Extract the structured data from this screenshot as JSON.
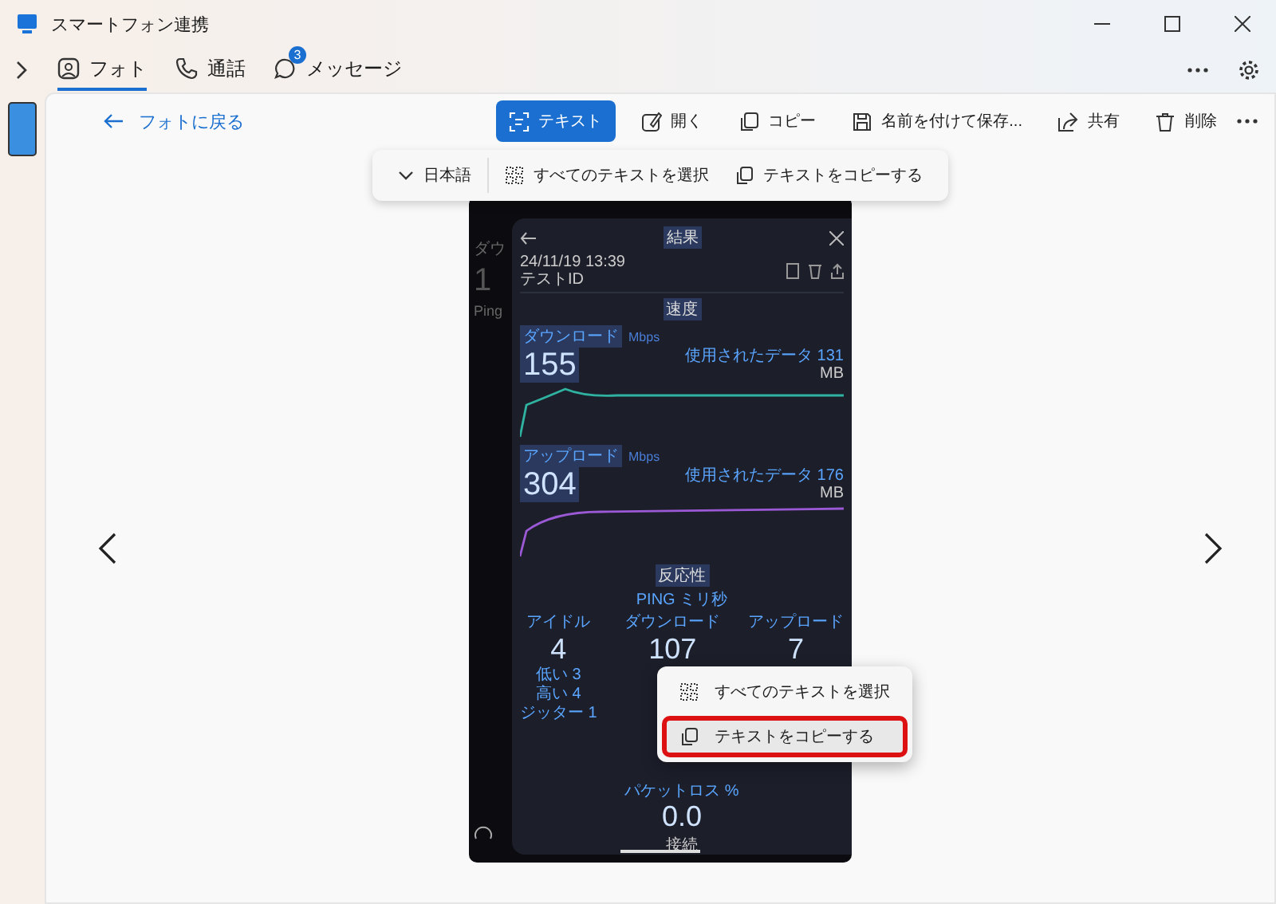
{
  "window": {
    "title": "スマートフォン連携"
  },
  "nav": {
    "tabs": [
      {
        "label": "フォト",
        "selected": true
      },
      {
        "label": "通話",
        "selected": false
      },
      {
        "label": "メッセージ",
        "selected": false,
        "badge": "3"
      }
    ]
  },
  "toolbar": {
    "back": "フォトに戻る",
    "actions": [
      {
        "label": "テキスト",
        "selected": true
      },
      {
        "label": "開く",
        "selected": false
      },
      {
        "label": "コピー",
        "selected": false
      },
      {
        "label": "名前を付けて保存...",
        "selected": false
      },
      {
        "label": "共有",
        "selected": false
      },
      {
        "label": "削除",
        "selected": false
      }
    ]
  },
  "text_bar": {
    "language": "日本語",
    "actions": [
      "すべてのテキストを選択",
      "テキストをコピーする"
    ]
  },
  "phone_screenshot": {
    "behind": {
      "label": "ダウ",
      "value": "1",
      "ping": "Ping"
    },
    "title": "結果",
    "date": "24/11/19 13:39",
    "test_id_label": "テストID",
    "speed_heading": "速度",
    "speeds": [
      {
        "label": "ダウンロード",
        "unit": "Mbps",
        "value": "155",
        "data_label": "使用されたデータ 131",
        "data_unit": "MB",
        "color": "#2fb3a0"
      },
      {
        "label": "アップロード",
        "unit": "Mbps",
        "value": "304",
        "data_label": "使用されたデータ 176",
        "data_unit": "MB",
        "color": "#9b59d6"
      }
    ],
    "responsiveness_heading": "反応性",
    "ping_label": "PING ミリ秒",
    "columns": [
      {
        "label": "アイドル",
        "value": "4",
        "low": "低い 3",
        "high": "高い 4",
        "jitter": "ジッター 1"
      },
      {
        "label": "ダウンロード",
        "value": "107"
      },
      {
        "label": "アップロード",
        "value": "7"
      }
    ],
    "packet_loss": {
      "label": "パケットロス %",
      "value": "0.0"
    },
    "connection_heading": "接続"
  },
  "context_menu": {
    "items": [
      {
        "label": "すべてのテキストを選択",
        "selected": false
      },
      {
        "label": "テキストをコピーする",
        "selected": true
      }
    ]
  }
}
